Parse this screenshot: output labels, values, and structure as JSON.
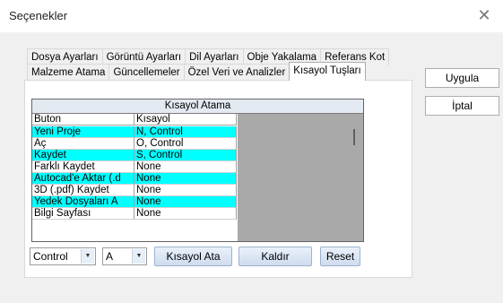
{
  "window": {
    "title": "Seçenekler",
    "close_glyph": "✕"
  },
  "tabs_row1": [
    "Dosya Ayarları",
    "Görüntü Ayarları",
    "Dil Ayarları",
    "Obje Yakalama",
    "Referans Kot"
  ],
  "tabs_row2": [
    "Malzeme Atama",
    "Güncellemeler",
    "Özel Veri ve Analizler",
    "Kısayol Tuşları"
  ],
  "active_tab": "Kısayol Tuşları",
  "grid": {
    "title": "Kısayol Atama",
    "columns": [
      "Buton",
      "Kısayol"
    ],
    "rows": [
      {
        "button": "Yeni Proje",
        "shortcut": "N, Control",
        "highlight": true
      },
      {
        "button": "Aç",
        "shortcut": "O, Control",
        "highlight": false
      },
      {
        "button": "Kaydet",
        "shortcut": "S, Control",
        "highlight": true
      },
      {
        "button": "Farklı Kaydet",
        "shortcut": "None",
        "highlight": false
      },
      {
        "button": "Autocad'e Aktar (.d",
        "shortcut": "None",
        "highlight": true
      },
      {
        "button": "3D (.pdf) Kaydet",
        "shortcut": "None",
        "highlight": false
      },
      {
        "button": "Yedek Dosyaları A",
        "shortcut": "None",
        "highlight": true
      },
      {
        "button": "Bilgi Sayfası",
        "shortcut": "None",
        "highlight": false
      }
    ]
  },
  "controls": {
    "modifier_value": "Control",
    "key_value": "A",
    "assign_label": "Kısayol Ata",
    "remove_label": "Kaldır",
    "reset_label": "Reset"
  },
  "side_buttons": {
    "apply_label": "Uygula",
    "cancel_label": "İptal"
  },
  "colors": {
    "highlight": "#00ffff",
    "grid_empty": "#a9a9a9",
    "header_bg": "#e4eaf1"
  }
}
